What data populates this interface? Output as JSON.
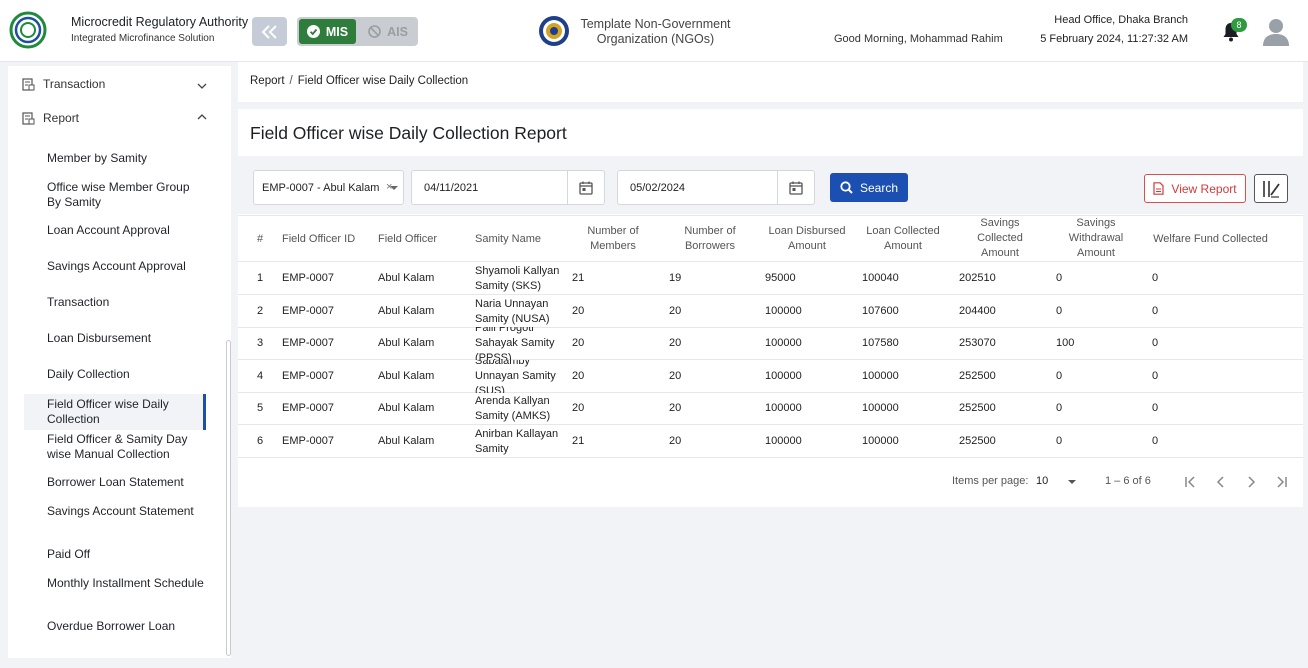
{
  "header": {
    "org_title": "Microcredit Regulatory Authority",
    "org_subtitle": "Integrated Microfinance Solution",
    "logo_text": "Microcredit Regulatory Authority",
    "modes": {
      "mis": "MIS",
      "ais": "AIS"
    },
    "ngo_name_line1": "Template Non-Government",
    "ngo_name_line2": "Organization (NGOs)",
    "greeting": "Good Morning, Mohammad Rahim",
    "branch": "Head Office, Dhaka Branch",
    "datetime": "5 February 2024, 11:27:32 AM",
    "notification_count": "8",
    "accent_green": "#2f7d3d"
  },
  "sidebar": {
    "groups": [
      {
        "label": "Transaction"
      },
      {
        "label": "Report"
      }
    ],
    "items": [
      {
        "label": "Member by Samity"
      },
      {
        "label": "Office wise Member Group By Samity"
      },
      {
        "label": "Loan Account Approval"
      },
      {
        "label": "Savings Account Approval"
      },
      {
        "label": "Transaction"
      },
      {
        "label": "Loan Disbursement"
      },
      {
        "label": "Daily Collection"
      },
      {
        "label": "Field Officer wise Daily Collection"
      },
      {
        "label": "Field Officer & Samity Day wise Manual Collection"
      },
      {
        "label": "Borrower Loan Statement"
      },
      {
        "label": "Savings Account Statement"
      },
      {
        "label": "Paid Off"
      },
      {
        "label": "Monthly Installment Schedule"
      },
      {
        "label": "Overdue Borrower Loan"
      }
    ]
  },
  "breadcrumb": {
    "root": "Report",
    "sep": "/",
    "current": "Field Officer wise Daily Collection"
  },
  "page": {
    "title": "Field Officer wise Daily Collection Report",
    "filters": {
      "officer": "EMP-0007 - Abul Kalam",
      "clear": "×",
      "from_date": "04/11/2021",
      "to_date": "05/02/2024",
      "search_label": "Search",
      "view_report_label": "View Report"
    }
  },
  "table": {
    "headers": {
      "idx": "#",
      "officer_id": "Field Officer ID",
      "officer": "Field Officer",
      "samity": "Samity Name",
      "members": "Number of Members",
      "borrowers": "Number of Borrowers",
      "disbursed": "Loan Disbursed Amount",
      "collected": "Loan Collected Amount",
      "savings_collected": "Savings Collected Amount",
      "savings_withdrawal": "Savings Withdrawal Amount",
      "welfare": "Welfare Fund Collected"
    },
    "rows": [
      {
        "idx": "1",
        "officer_id": "EMP-0007",
        "officer": "Abul Kalam",
        "samity": "Shyamoli Kallyan Samity (SKS)",
        "members": "21",
        "borrowers": "19",
        "disbursed": "95000",
        "collected": "100040",
        "savings_collected": "202510",
        "savings_withdrawal": "0",
        "welfare": "0"
      },
      {
        "idx": "2",
        "officer_id": "EMP-0007",
        "officer": "Abul Kalam",
        "samity": "Naria Unnayan Samity (NUSA)",
        "members": "20",
        "borrowers": "20",
        "disbursed": "100000",
        "collected": "107600",
        "savings_collected": "204400",
        "savings_withdrawal": "0",
        "welfare": "0"
      },
      {
        "idx": "3",
        "officer_id": "EMP-0007",
        "officer": "Abul Kalam",
        "samity": "Palli Progoti Sahayak Samity (PPSS)",
        "members": "20",
        "borrowers": "20",
        "disbursed": "100000",
        "collected": "107580",
        "savings_collected": "253070",
        "savings_withdrawal": "100",
        "welfare": "0"
      },
      {
        "idx": "4",
        "officer_id": "EMP-0007",
        "officer": "Abul Kalam",
        "samity": "Sabalamby Unnayan Samity (SUS)",
        "members": "20",
        "borrowers": "20",
        "disbursed": "100000",
        "collected": "100000",
        "savings_collected": "252500",
        "savings_withdrawal": "0",
        "welfare": "0"
      },
      {
        "idx": "5",
        "officer_id": "EMP-0007",
        "officer": "Abul Kalam",
        "samity": "Arenda Kallyan Samity (AMKS)",
        "members": "20",
        "borrowers": "20",
        "disbursed": "100000",
        "collected": "100000",
        "savings_collected": "252500",
        "savings_withdrawal": "0",
        "welfare": "0"
      },
      {
        "idx": "6",
        "officer_id": "EMP-0007",
        "officer": "Abul Kalam",
        "samity": "Anirban Kallayan Samity",
        "members": "21",
        "borrowers": "20",
        "disbursed": "100000",
        "collected": "100000",
        "savings_collected": "252500",
        "savings_withdrawal": "0",
        "welfare": "0"
      }
    ]
  },
  "pagination": {
    "items_per_page_label": "Items per page:",
    "items_per_page": "10",
    "range": "1 – 6 of 6"
  }
}
